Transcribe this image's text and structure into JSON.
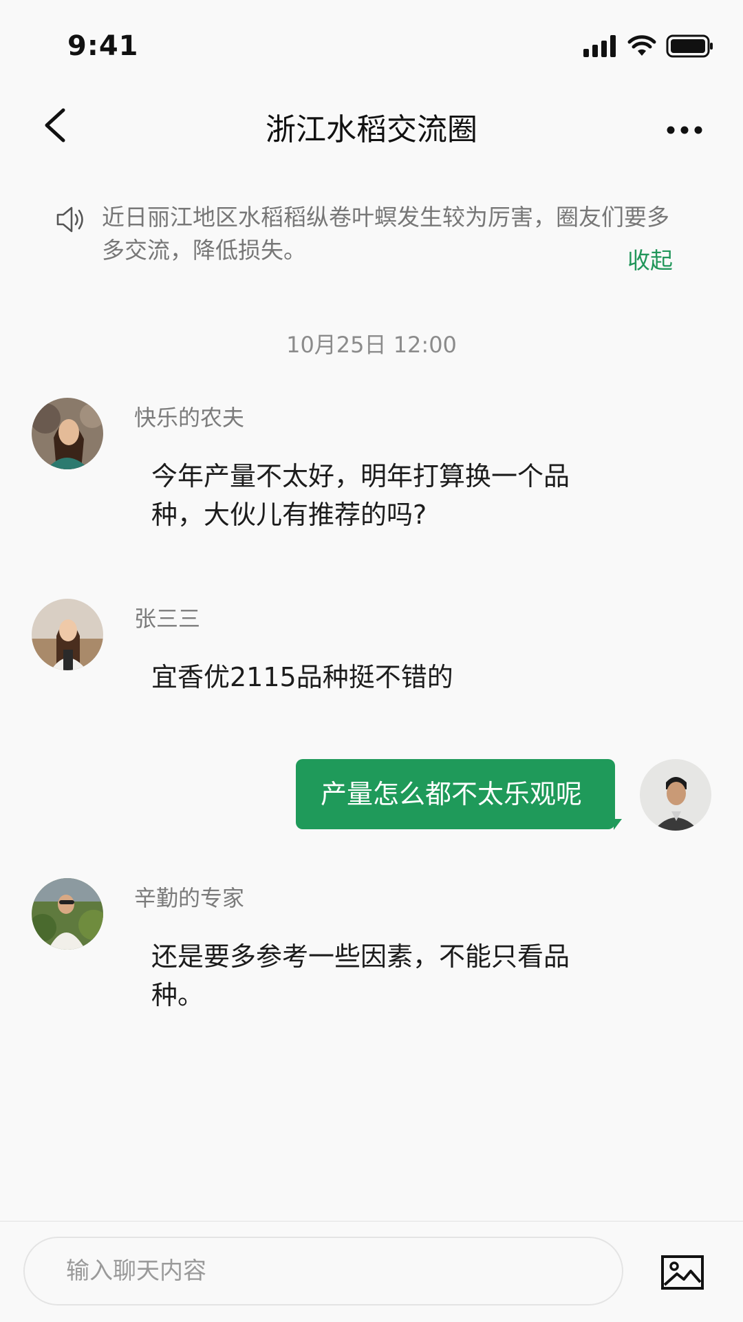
{
  "status_bar": {
    "time": "9:41"
  },
  "nav": {
    "title": "浙江水稻交流圈"
  },
  "notice": {
    "text": "近日丽江地区水稻稻纵卷叶螟发生较为厉害，圈友们要多多交流，降低损失。",
    "collapse_label": "收起"
  },
  "timestamp": "10月25日 12:00",
  "messages": [
    {
      "sender": "快乐的农夫",
      "text": "今年产量不太好，明年打算换一个品种，大伙儿有推荐的吗?"
    },
    {
      "sender": "张三三",
      "text": "宜香优2115品种挺不错的"
    },
    {
      "sender": "",
      "text": "产量怎么都不太乐观呢",
      "outgoing": true
    },
    {
      "sender": "辛勤的专家",
      "text": "还是要多参考一些因素，不能只看品种。"
    }
  ],
  "input": {
    "placeholder": "输入聊天内容",
    "value": ""
  },
  "colors": {
    "accent": "#1f9a5a",
    "background": "#f9f9f9"
  }
}
